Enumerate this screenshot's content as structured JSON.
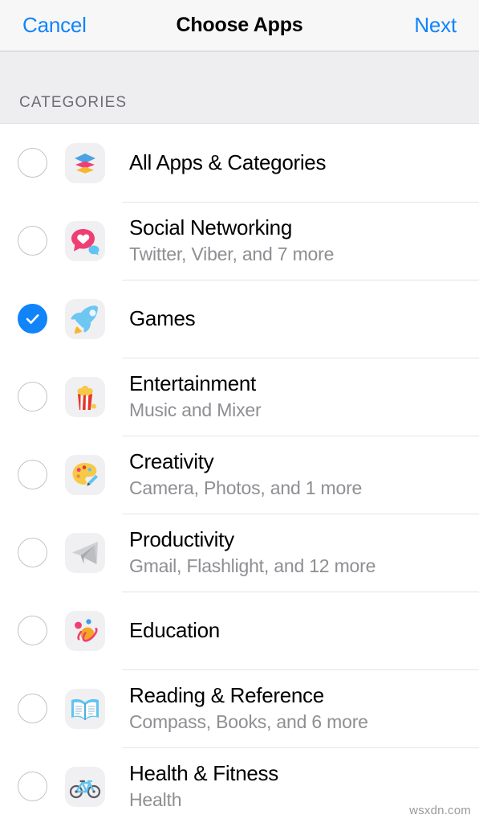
{
  "navbar": {
    "cancel_label": "Cancel",
    "title": "Choose Apps",
    "next_label": "Next",
    "tint_color": "#1184fa"
  },
  "section": {
    "header_label": "CATEGORIES"
  },
  "theme": {
    "selected_color": "#1184fa",
    "unselected_border": "#c3c3c5",
    "title_color": "#000000",
    "subtitle_color": "#8e8e93",
    "tile_background": "#f0f0f2",
    "separator_color": "#e4e4e6",
    "section_background": "#eeeef0",
    "navbar_background": "#f7f7f8"
  },
  "categories": [
    {
      "title": "All Apps & Categories",
      "subtitle": "",
      "selected": false,
      "icon": "layers-icon"
    },
    {
      "title": "Social Networking",
      "subtitle": "Twitter, Viber, and 7 more",
      "selected": false,
      "icon": "chat-heart-icon"
    },
    {
      "title": "Games",
      "subtitle": "",
      "selected": true,
      "icon": "rocket-icon"
    },
    {
      "title": "Entertainment",
      "subtitle": "Music and Mixer",
      "selected": false,
      "icon": "popcorn-icon"
    },
    {
      "title": "Creativity",
      "subtitle": "Camera, Photos, and 1 more",
      "selected": false,
      "icon": "palette-icon"
    },
    {
      "title": "Productivity",
      "subtitle": "Gmail, Flashlight, and 12 more",
      "selected": false,
      "icon": "paper-plane-icon"
    },
    {
      "title": "Education",
      "subtitle": "",
      "selected": false,
      "icon": "planet-icon"
    },
    {
      "title": "Reading & Reference",
      "subtitle": "Compass, Books, and 6 more",
      "selected": false,
      "icon": "open-book-icon"
    },
    {
      "title": "Health & Fitness",
      "subtitle": "Health",
      "selected": false,
      "icon": "bicycle-icon"
    }
  ],
  "watermark": {
    "text": "wsxdn.com"
  }
}
